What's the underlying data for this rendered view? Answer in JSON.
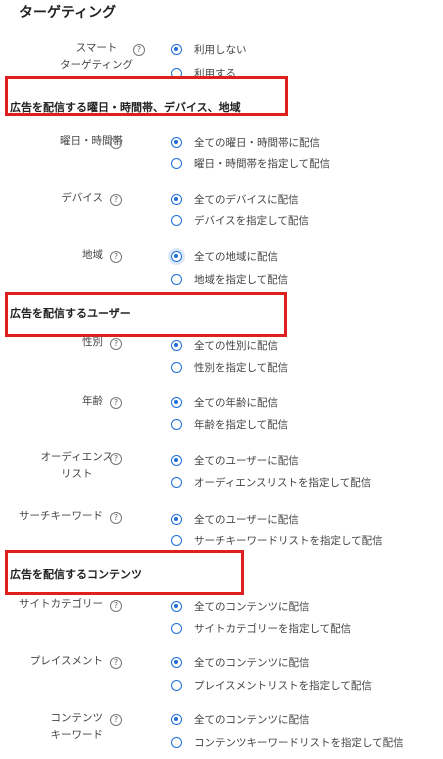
{
  "page_title": "ターゲティング",
  "help_symbol": "?",
  "smart": {
    "label_line1": "スマート",
    "label_line2": "ターゲティング",
    "options": [
      "利用しない",
      "利用する"
    ]
  },
  "section_weekday_device_region": {
    "title": "広告を配信する曜日・時間帯、デバイス、地域",
    "weekday": {
      "label": "曜日・時間帯",
      "options": [
        "全ての曜日・時間帯に配信",
        "曜日・時間帯を指定して配信"
      ]
    },
    "device": {
      "label": "デバイス",
      "options": [
        "全てのデバイスに配信",
        "デバイスを指定して配信"
      ]
    },
    "region": {
      "label": "地域",
      "options": [
        "全ての地域に配信",
        "地域を指定して配信"
      ]
    }
  },
  "section_users": {
    "title": "広告を配信するユーザー",
    "gender": {
      "label": "性別",
      "options": [
        "全ての性別に配信",
        "性別を指定して配信"
      ]
    },
    "age": {
      "label": "年齢",
      "options": [
        "全ての年齢に配信",
        "年齢を指定して配信"
      ]
    },
    "audience": {
      "label_line1": "オーディエンス",
      "label_line2": "リスト",
      "options": [
        "全てのユーザーに配信",
        "オーディエンスリストを指定して配信"
      ]
    },
    "search_keyword": {
      "label": "サーチキーワード",
      "options": [
        "全てのユーザーに配信",
        "サーチキーワードリストを指定して配信"
      ]
    }
  },
  "section_contents": {
    "title": "広告を配信するコンテンツ",
    "site_category": {
      "label": "サイトカテゴリー",
      "options": [
        "全てのコンテンツに配信",
        "サイトカテゴリーを指定して配信"
      ]
    },
    "placement": {
      "label": "プレイスメント",
      "options": [
        "全てのコンテンツに配信",
        "プレイスメントリストを指定して配信"
      ]
    },
    "content_keyword": {
      "label_line1": "コンテンツ",
      "label_line2": "キーワード",
      "options": [
        "全てのコンテンツに配信",
        "コンテンツキーワードリストを指定して配信"
      ]
    }
  },
  "colors": {
    "accent": "#1e6fd9",
    "highlight_border": "#e01f1f"
  }
}
